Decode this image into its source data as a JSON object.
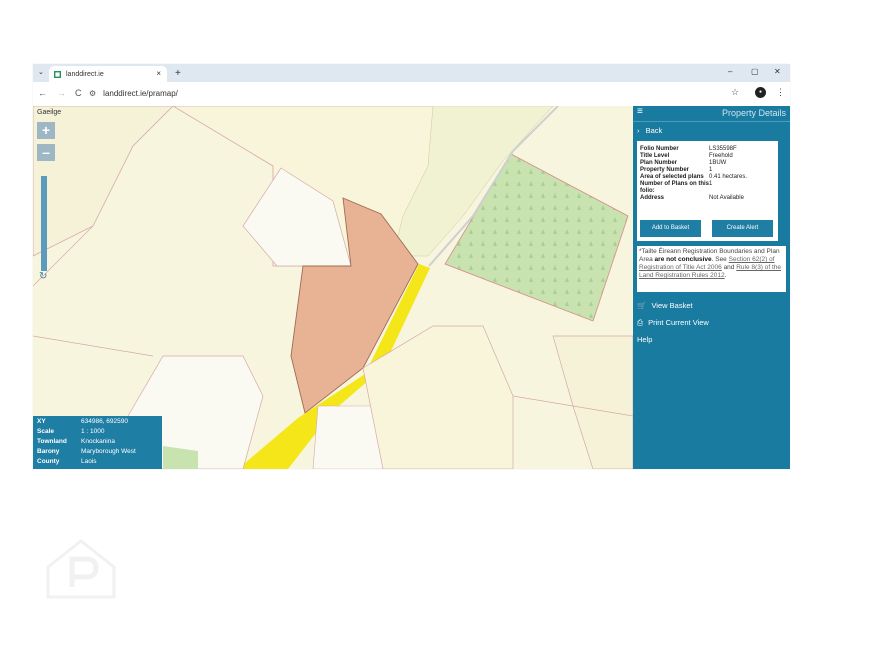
{
  "browser": {
    "tab_title": "landdirect.ie",
    "tab_close": "×",
    "tab_list_icon": "chevron-down-icon",
    "new_tab": "+",
    "window_minimize": "–",
    "window_maximize": "▢",
    "window_close": "✕",
    "back": "←",
    "forward": "→",
    "reload": "C",
    "url": "landdirect.ie/pramap/",
    "bookmark_star": "☆",
    "menu_dots": "⋮"
  },
  "map": {
    "language_link": "Gaeilge",
    "zoom_in": "+",
    "zoom_out": "–",
    "refresh_icon": "↻",
    "colors": {
      "background": "#f7f5dd",
      "selected_plot": "#e8b294",
      "road_yellow": "#f5e61a",
      "forest": "#c8e3b0"
    },
    "info": [
      {
        "label": "XY",
        "value": "634986, 692590"
      },
      {
        "label": "Scale",
        "value": "1 : 1000"
      },
      {
        "label": "Townland",
        "value": "Knockanina"
      },
      {
        "label": "Barony",
        "value": "Maryborough West"
      },
      {
        "label": "County",
        "value": "Laois"
      }
    ]
  },
  "panel": {
    "title": "Property Details",
    "back": "Back",
    "details": [
      {
        "label": "Folio Number",
        "value": "LS35598F"
      },
      {
        "label": "Title Level",
        "value": "Freehold"
      },
      {
        "label": "Plan Number",
        "value": "1BUW"
      },
      {
        "label": "Property Number",
        "value": "1"
      },
      {
        "label": "Area of selected plans",
        "value": "0.41 hectares."
      },
      {
        "label": "Number of Plans on this folio:",
        "value": "1"
      },
      {
        "label": "Address",
        "value": "Not Available"
      }
    ],
    "add_to_basket": "Add to Basket",
    "create_alert": "Create Alert",
    "notice": {
      "part1": "*Tailte Éireann Registration Boundaries and Plan Area",
      "bold": "are not conclusive",
      "part2": ". See",
      "link1": "Section 62(2) of Registration of Title Act 2006",
      "and": "and",
      "link2": "Rule 8(3) of the Land Registration Rules 2012",
      "end": "."
    },
    "view_basket": "View Basket",
    "print_view": "Print Current View",
    "help": "Help",
    "accent_color": "#1a7ba0"
  }
}
